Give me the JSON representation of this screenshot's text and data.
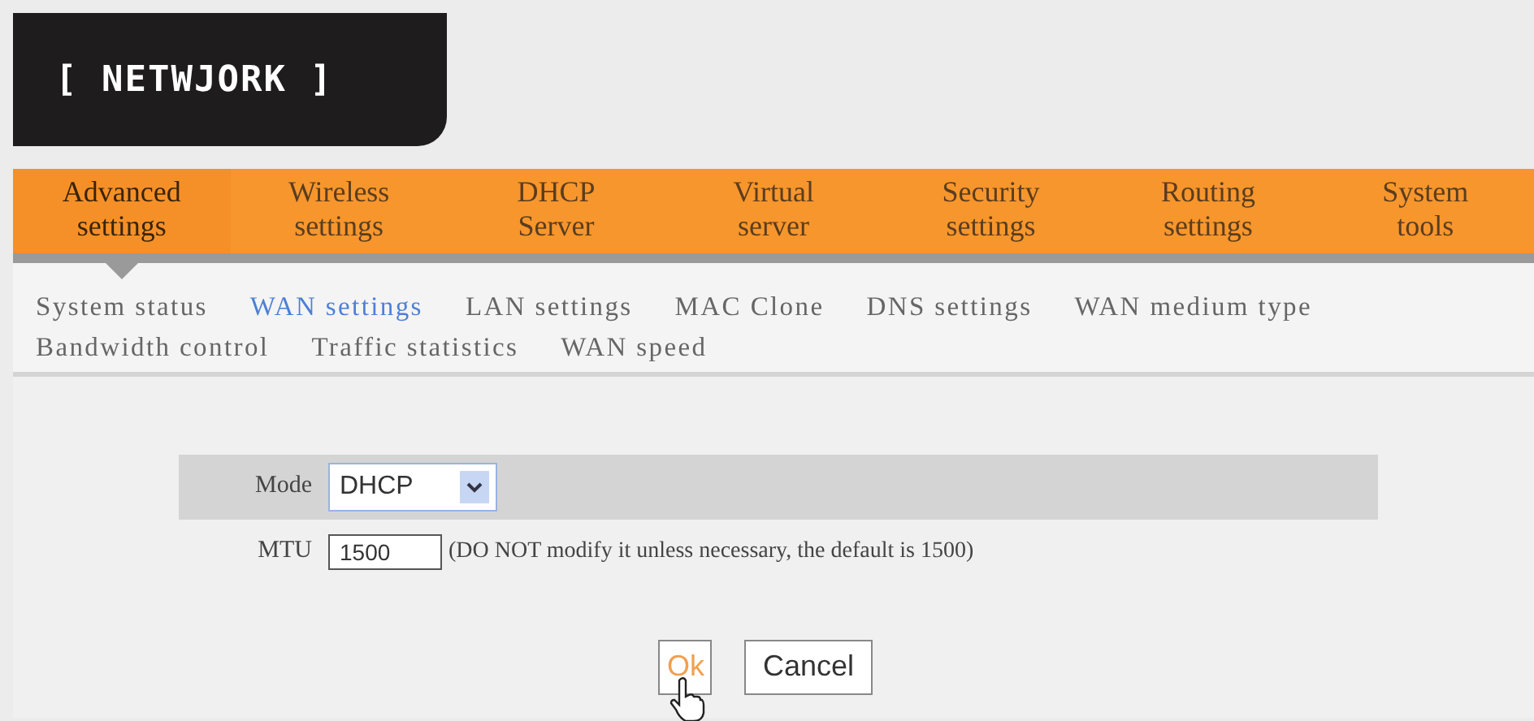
{
  "section_label": "[ NETWJORK ]",
  "main_tabs": [
    {
      "label": "Advanced settings",
      "selected": true
    },
    {
      "label": "Wireless settings",
      "selected": false
    },
    {
      "label": "DHCP Server",
      "selected": false
    },
    {
      "label": "Virtual server",
      "selected": false
    },
    {
      "label": "Security settings",
      "selected": false
    },
    {
      "label": "Routing settings",
      "selected": false
    },
    {
      "label": "System tools",
      "selected": false
    }
  ],
  "sub_tabs": [
    {
      "label": "System status",
      "selected": false
    },
    {
      "label": "WAN settings",
      "selected": true
    },
    {
      "label": "LAN settings",
      "selected": false
    },
    {
      "label": "MAC Clone",
      "selected": false
    },
    {
      "label": "DNS settings",
      "selected": false
    },
    {
      "label": "WAN medium type",
      "selected": false
    },
    {
      "label": "Bandwidth control",
      "selected": false
    },
    {
      "label": "Traffic statistics",
      "selected": false
    },
    {
      "label": "WAN speed",
      "selected": false
    }
  ],
  "form": {
    "mode": {
      "label": "Mode",
      "value": "DHCP"
    },
    "mtu": {
      "label": "MTU",
      "value": "1500",
      "hint": "(DO NOT modify it unless necessary, the default is 1500)"
    }
  },
  "buttons": [
    {
      "label": "Ok",
      "hovered": true
    },
    {
      "label": "Cancel",
      "hovered": false
    }
  ]
}
